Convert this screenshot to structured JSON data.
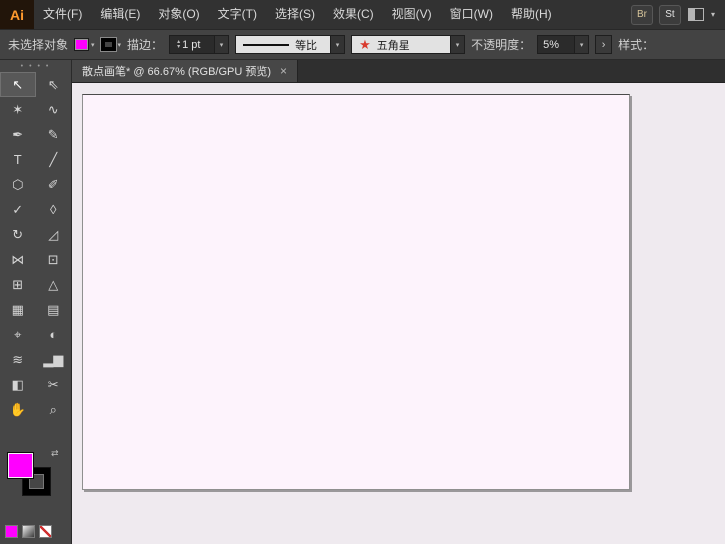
{
  "app": {
    "logo_text": "Ai"
  },
  "menubar": {
    "items": [
      {
        "name": "menu-file",
        "label": "文件(F)"
      },
      {
        "name": "menu-edit",
        "label": "编辑(E)"
      },
      {
        "name": "menu-object",
        "label": "对象(O)"
      },
      {
        "name": "menu-type",
        "label": "文字(T)"
      },
      {
        "name": "menu-select",
        "label": "选择(S)"
      },
      {
        "name": "menu-effect",
        "label": "效果(C)"
      },
      {
        "name": "menu-view",
        "label": "视图(V)"
      },
      {
        "name": "menu-window",
        "label": "窗口(W)"
      },
      {
        "name": "menu-help",
        "label": "帮助(H)"
      }
    ],
    "badges": [
      {
        "name": "bridge-badge",
        "label": "Br"
      },
      {
        "name": "stock-badge",
        "label": "St"
      }
    ]
  },
  "control_bar": {
    "selection_status": "未选择对象",
    "fill_color": "#ff00ff",
    "stroke_color": "#000000",
    "stroke_label": "描边：",
    "stroke_weight": "1 pt",
    "profile_value": "等比",
    "brush_value": "五角星",
    "brush_star_glyph": "★",
    "brush_star_color": "#d93a2e",
    "opacity_label": "不透明度：",
    "opacity_value": "5%",
    "style_label": "样式："
  },
  "document": {
    "tab_title": "散点画笔* @ 66.67% (RGB/GPU 预览)",
    "close_glyph": "×",
    "artboard_color": "#fdf3fc"
  },
  "toolbar": {
    "tools": [
      {
        "name": "selection-tool",
        "glyph": "↖",
        "selected": true
      },
      {
        "name": "direct-selection-tool",
        "glyph": "⇖"
      },
      {
        "name": "magic-wand-tool",
        "glyph": "✶"
      },
      {
        "name": "lasso-tool",
        "glyph": "∿"
      },
      {
        "name": "pen-tool",
        "glyph": "✒"
      },
      {
        "name": "curvature-tool",
        "glyph": "✎"
      },
      {
        "name": "type-tool",
        "glyph": "T"
      },
      {
        "name": "line-segment-tool",
        "glyph": "╱"
      },
      {
        "name": "polygon-tool",
        "glyph": "⬡"
      },
      {
        "name": "paintbrush-tool",
        "glyph": "✐"
      },
      {
        "name": "shaper-tool",
        "glyph": "✓"
      },
      {
        "name": "eraser-tool",
        "glyph": "◊"
      },
      {
        "name": "rotate-tool",
        "glyph": "↻"
      },
      {
        "name": "scale-tool",
        "glyph": "◿"
      },
      {
        "name": "width-tool",
        "glyph": "⋈"
      },
      {
        "name": "free-transform-tool",
        "glyph": "⊡"
      },
      {
        "name": "shape-builder-tool",
        "glyph": "⊞"
      },
      {
        "name": "perspective-grid-tool",
        "glyph": "△"
      },
      {
        "name": "mesh-tool",
        "glyph": "▦"
      },
      {
        "name": "gradient-tool",
        "glyph": "▤"
      },
      {
        "name": "eyedropper-tool",
        "glyph": "⌖"
      },
      {
        "name": "blend-tool",
        "glyph": "◐"
      },
      {
        "name": "symbol-sprayer-tool",
        "glyph": "≋"
      },
      {
        "name": "column-graph-tool",
        "glyph": "▂▆"
      },
      {
        "name": "artboard-tool",
        "glyph": "◧"
      },
      {
        "name": "slice-tool",
        "glyph": "✂"
      },
      {
        "name": "hand-tool",
        "glyph": "✋"
      },
      {
        "name": "zoom-tool",
        "glyph": "⌕"
      }
    ]
  },
  "icons": {
    "chevron_down": "▾",
    "stepper_up": "▴",
    "stepper_down": "▾",
    "swap": "⇄",
    "grip": "• • • •",
    "more": "›",
    "workspace_chevron": "▾"
  }
}
